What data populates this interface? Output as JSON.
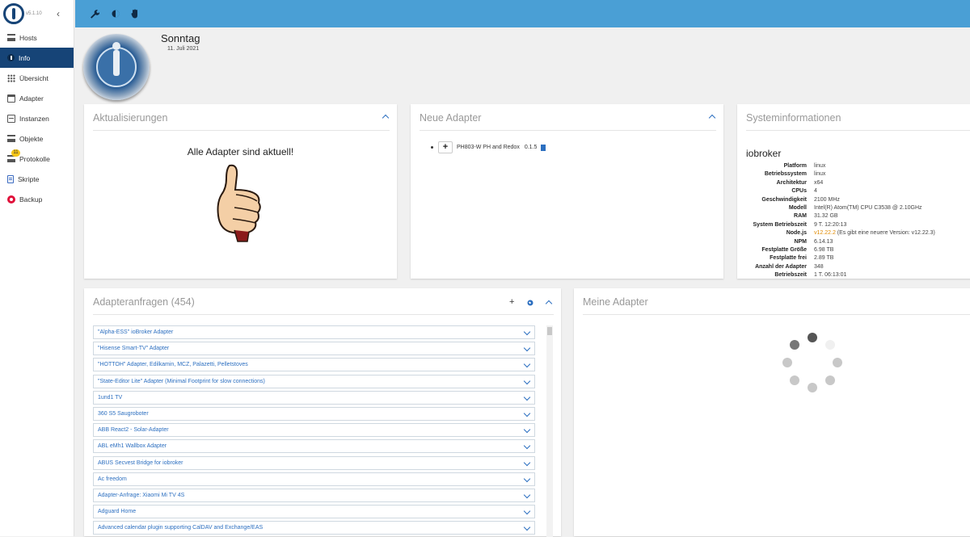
{
  "app": {
    "version": "v5.1.10"
  },
  "sidebar": {
    "items": [
      {
        "label": "Hosts",
        "icon": "hosts-icon",
        "active": false
      },
      {
        "label": "Info",
        "icon": "info-icon",
        "active": true
      },
      {
        "label": "Übersicht",
        "icon": "grid-icon",
        "active": false
      },
      {
        "label": "Adapter",
        "icon": "store-icon",
        "active": false
      },
      {
        "label": "Instanzen",
        "icon": "instances-icon",
        "active": false
      },
      {
        "label": "Objekte",
        "icon": "objects-icon",
        "active": false
      },
      {
        "label": "Protokolle",
        "icon": "logs-icon",
        "active": false,
        "badge": "11"
      },
      {
        "label": "Skripte",
        "icon": "scripts-icon",
        "active": false
      },
      {
        "label": "Backup",
        "icon": "backup-icon",
        "active": false
      }
    ]
  },
  "toolbar": {
    "icons": [
      "wrench-icon",
      "brightness-icon",
      "hand-icon"
    ]
  },
  "date": {
    "day": "Sonntag",
    "full": "11. Juli 2021"
  },
  "updates": {
    "title": "Aktualisierungen",
    "message": "Alle Adapter sind aktuell!"
  },
  "new_adapters": {
    "title": "Neue Adapter",
    "items": [
      {
        "name": "PH803-W PH and Redox",
        "version": "0.1.5"
      }
    ]
  },
  "sysinfo": {
    "title": "Systeminformationen",
    "host": "iobroker",
    "rows": [
      {
        "k": "Platform",
        "v": "linux"
      },
      {
        "k": "Betriebssystem",
        "v": "linux"
      },
      {
        "k": "Architektur",
        "v": "x64"
      },
      {
        "k": "CPUs",
        "v": "4"
      },
      {
        "k": "Geschwindigkeit",
        "v": "2100 MHz"
      },
      {
        "k": "Modell",
        "v": "Intel(R) Atom(TM) CPU C3538 @ 2.10GHz"
      },
      {
        "k": "RAM",
        "v": "31.32 GB"
      },
      {
        "k": "System Betriebszeit",
        "v": "9 T. 12:20:13"
      },
      {
        "k": "Node.js",
        "v": "v12.22.2",
        "note": " (Es gibt eine neuere Version: v12.22.3)"
      },
      {
        "k": "NPM",
        "v": "6.14.13"
      },
      {
        "k": "Festplatte Größe",
        "v": "6.98 TB"
      },
      {
        "k": "Festplatte frei",
        "v": "2.89 TB"
      },
      {
        "k": "Anzahl der Adapter",
        "v": "348"
      },
      {
        "k": "Betriebszeit",
        "v": "1 T. 06:13:01"
      }
    ]
  },
  "requests": {
    "title": "Adapteranfragen (454)",
    "items": [
      "\"Alpha-ESS\" ioBroker Adapter",
      "\"Hisense Smart-TV\" Adapter",
      "\"HOTTOH\" Adapter, Edilkamin, MCZ, Palazetti, Pelletstoves",
      "\"State-Editor Lite\" Adapter (Minimal Footprint for slow connections)",
      "1und1 TV",
      "360 S5 Saugroboter",
      "ABB React2 - Solar-Adapter",
      "ABL eMh1 Wallbox Adapter",
      "ABUS Secvest Bridge for iobroker",
      "Ac freedom",
      "Adapter-Anfrage: Xiaomi Mi TV 4S",
      "Adguard Home",
      "Advanced calendar plugin supporting CalDAV and Exchange/EAS"
    ]
  },
  "my_adapters": {
    "title": "Meine Adapter"
  }
}
